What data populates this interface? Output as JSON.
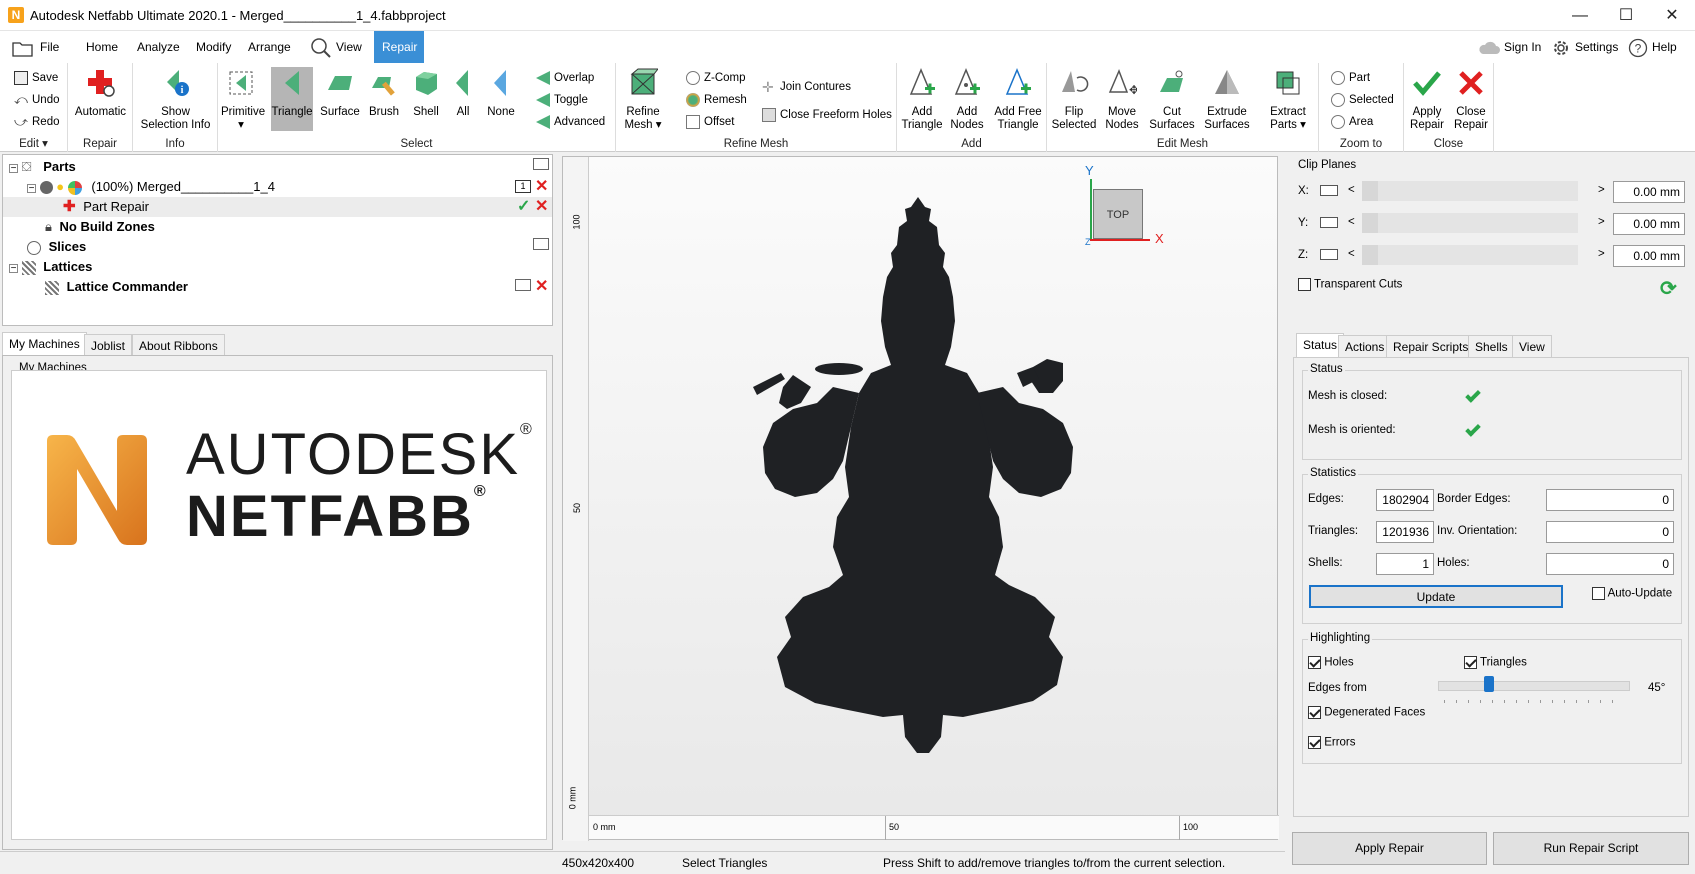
{
  "window": {
    "title": "Autodesk Netfabb Ultimate 2020.1 - Merged__________1_4.fabbproject",
    "app_logo": "N",
    "minimize": "—",
    "maximize": "☐",
    "close": "✕"
  },
  "menu": {
    "file": "File",
    "home": "Home",
    "analyze": "Analyze",
    "modify": "Modify",
    "arrange": "Arrange",
    "view": "View",
    "repair": "Repair",
    "sign_in": "Sign In",
    "settings": "Settings",
    "help": "Help"
  },
  "ribbon": {
    "edit": {
      "save": "Save",
      "undo": "Undo",
      "redo": "Redo",
      "label": "Edit ▾"
    },
    "repair": {
      "automatic": "Automatic",
      "label": "Repair"
    },
    "info": {
      "show_selection_info_1": "Show",
      "show_selection_info_2": "Selection Info",
      "label": "Info"
    },
    "select": {
      "primitive": "Primitive",
      "primitive_arrow": "▾",
      "triangle": "Triangle",
      "surface": "Surface",
      "brush": "Brush",
      "shell": "Shell",
      "all": "All",
      "none": "None",
      "overlap": "Overlap",
      "toggle": "Toggle",
      "advanced": "Advanced",
      "label": "Select"
    },
    "refine_mesh": {
      "refine_1": "Refine",
      "refine_2": "Mesh ▾",
      "zcomp": "Z-Comp",
      "remesh": "Remesh",
      "offset": "Offset",
      "join_contures": "Join Contures",
      "close_freeform_holes": "Close Freeform Holes",
      "label": "Refine Mesh"
    },
    "add": {
      "add_triangle_1": "Add",
      "add_triangle_2": "Triangle",
      "add_nodes_1": "Add",
      "add_nodes_2": "Nodes",
      "add_free_triangle_1": "Add Free",
      "add_free_triangle_2": "Triangle",
      "label": "Add"
    },
    "edit_mesh": {
      "flip_1": "Flip",
      "flip_2": "Selected",
      "move_1": "Move",
      "move_2": "Nodes",
      "cut_1": "Cut",
      "cut_2": "Surfaces",
      "extrude_1": "Extrude",
      "extrude_2": "Surfaces",
      "extract_1": "Extract",
      "extract_2": "Parts ▾",
      "label": "Edit Mesh"
    },
    "zoom_to": {
      "part": "Part",
      "selected": "Selected",
      "area": "Area",
      "label": "Zoom to"
    },
    "close": {
      "apply_1": "Apply",
      "apply_2": "Repair",
      "close_1": "Close",
      "close_2": "Repair",
      "label": "Close"
    }
  },
  "tree": {
    "parts": "Parts",
    "merged": "(100%) Merged__________1_4",
    "badge": "1",
    "part_repair": "Part Repair",
    "no_build_zones": "No Build Zones",
    "slices": "Slices",
    "lattices": "Lattices",
    "lattice_commander": "Lattice Commander"
  },
  "left_tabs": {
    "my_machines": "My Machines",
    "joblist": "Joblist",
    "about_ribbons": "About Ribbons",
    "group_title": "My Machines",
    "logo_line1": "AUTODESK",
    "logo_line2": "NETFABB",
    "reg": "®"
  },
  "viewport": {
    "ruler_v": [
      "100",
      "50",
      "0 mm"
    ],
    "ruler_h": [
      "0 mm",
      "50",
      "100"
    ],
    "axis_y": "Y",
    "axis_x": "X",
    "axis_z": "Z",
    "cube_label": "TOP"
  },
  "clip_planes": {
    "title": "Clip Planes",
    "x_label": "X:",
    "y_label": "Y:",
    "z_label": "Z:",
    "x_value": "0.00 mm",
    "y_value": "0.00 mm",
    "z_value": "0.00 mm",
    "lt": "<",
    "gt": ">",
    "transparent_cuts": "Transparent Cuts"
  },
  "right_tabs": {
    "status": "Status",
    "actions": "Actions",
    "repair_scripts": "Repair Scripts",
    "shells": "Shells",
    "view": "View"
  },
  "status": {
    "title": "Status",
    "mesh_closed": "Mesh is closed:",
    "mesh_oriented": "Mesh is oriented:"
  },
  "statistics": {
    "title": "Statistics",
    "edges_label": "Edges:",
    "edges_value": "1802904",
    "border_edges_label": "Border Edges:",
    "border_edges_value": "0",
    "triangles_label": "Triangles:",
    "triangles_value": "1201936",
    "inv_orientation_label": "Inv. Orientation:",
    "inv_orientation_value": "0",
    "shells_label": "Shells:",
    "shells_value": "1",
    "holes_label": "Holes:",
    "holes_value": "0",
    "update": "Update",
    "auto_update": "Auto-Update"
  },
  "highlighting": {
    "title": "Highlighting",
    "holes": "Holes",
    "triangles": "Triangles",
    "edges_from": "Edges from",
    "edges_value": "45°",
    "degenerated_faces": "Degenerated Faces",
    "errors": "Errors"
  },
  "bottom_buttons": {
    "apply_repair": "Apply Repair",
    "run_repair_script": "Run Repair Script"
  },
  "statusbar": {
    "dims": "450x420x400",
    "mode": "Select Triangles",
    "hint": "Press Shift to add/remove triangles to/from the current selection."
  },
  "colors": {
    "accent": "#3a8fd6",
    "green": "#2aa64a",
    "red": "#e02020",
    "model": "#1f2124"
  }
}
